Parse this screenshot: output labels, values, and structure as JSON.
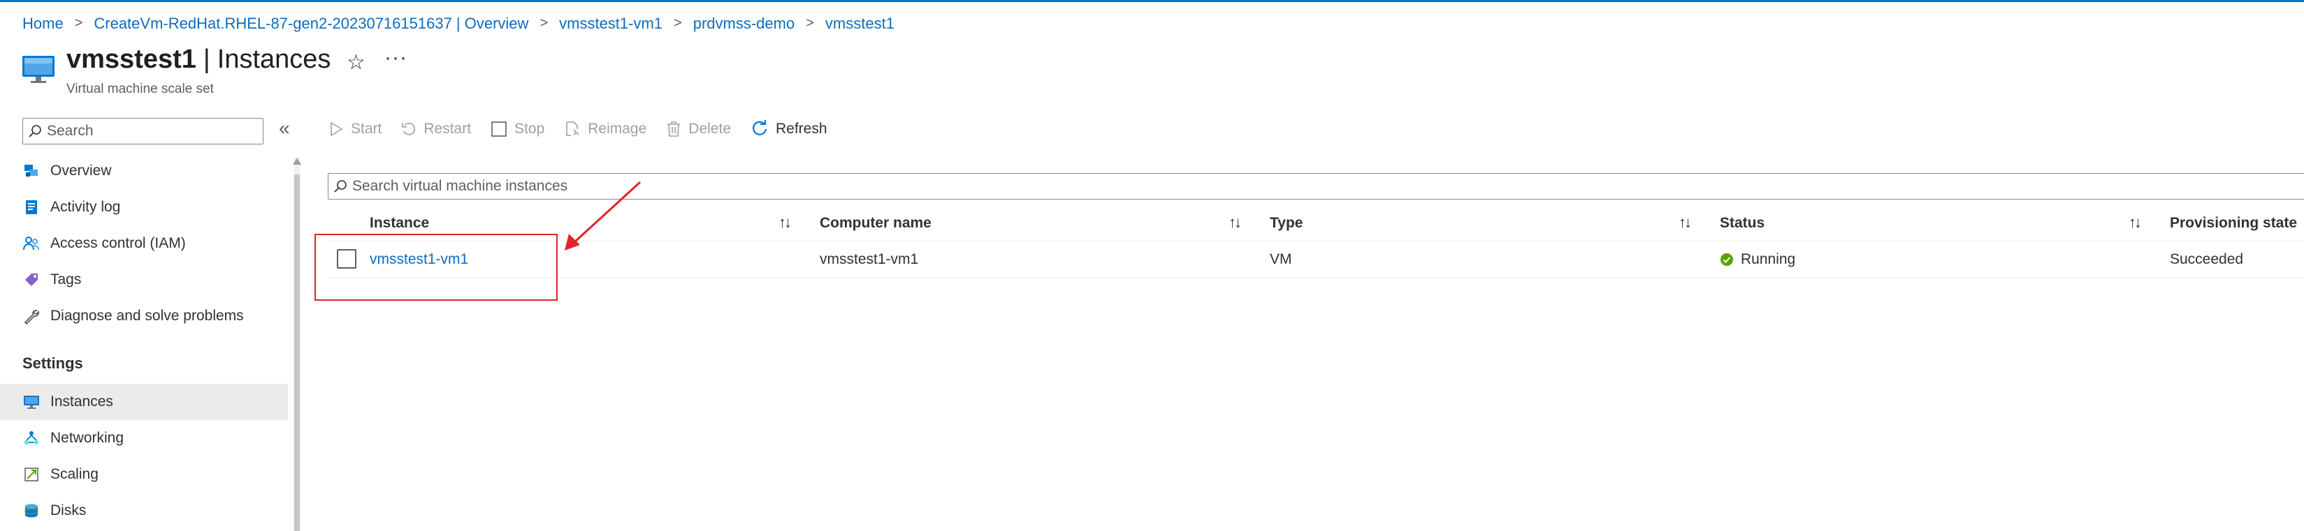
{
  "breadcrumb": {
    "items": [
      "Home",
      "CreateVm-RedHat.RHEL-87-gen2-20230716151637 | Overview",
      "vmsstest1-vm1",
      "prdvmss-demo",
      "vmsstest1"
    ],
    "separator": ">"
  },
  "header": {
    "resource_name": "vmsstest1",
    "separator": "|",
    "page_name": "Instances",
    "subtitle": "Virtual machine scale set",
    "favorite_icon": "star-icon",
    "more_label": "···"
  },
  "sidebar": {
    "search_placeholder": "Search",
    "collapse_label": "«",
    "items": [
      {
        "label": "Overview",
        "icon": "overview-icon"
      },
      {
        "label": "Activity log",
        "icon": "activity-log-icon"
      },
      {
        "label": "Access control (IAM)",
        "icon": "people-icon"
      },
      {
        "label": "Tags",
        "icon": "tag-icon"
      },
      {
        "label": "Diagnose and solve problems",
        "icon": "wrench-icon"
      }
    ],
    "section_title": "Settings",
    "settings_items": [
      {
        "label": "Instances",
        "icon": "instances-icon",
        "selected": true
      },
      {
        "label": "Networking",
        "icon": "networking-icon"
      },
      {
        "label": "Scaling",
        "icon": "scaling-icon"
      },
      {
        "label": "Disks",
        "icon": "disks-icon"
      }
    ]
  },
  "toolbar": {
    "start": "Start",
    "restart": "Restart",
    "stop": "Stop",
    "reimage": "Reimage",
    "delete": "Delete",
    "refresh": "Refresh"
  },
  "grid": {
    "search_placeholder": "Search virtual machine instances",
    "columns": [
      "Instance",
      "Computer name",
      "Type",
      "Status",
      "Provisioning state"
    ],
    "sort_glyph": "↑↓",
    "rows": [
      {
        "instance": "vmsstest1-vm1",
        "computer_name": "vmsstest1-vm1",
        "type": "VM",
        "status": "Running",
        "provisioning_state": "Succeeded"
      }
    ]
  },
  "colors": {
    "accent": "#0078d4",
    "link": "#0f6cbd",
    "status_running": "#57a300",
    "annotation": "#e0242b"
  }
}
